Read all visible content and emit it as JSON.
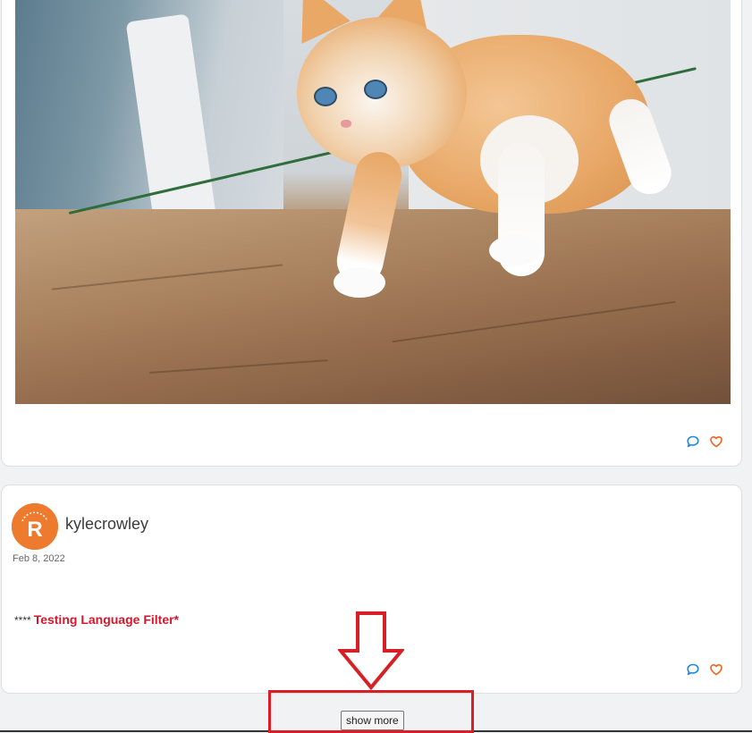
{
  "posts": [
    {
      "image_alt": "orange and white kitten walking on a wooden table",
      "actions": {
        "comment_icon": "comment-icon",
        "like_icon": "heart-icon"
      }
    },
    {
      "avatar_letter": "R",
      "username": "kylecrowley",
      "date": "Feb 8, 2022",
      "censored": "****",
      "message": "Testing Language Filter*",
      "actions": {
        "comment_icon": "comment-icon",
        "like_icon": "heart-icon"
      }
    }
  ],
  "show_more_label": "show more",
  "colors": {
    "comment_icon": "#1e88e5",
    "heart_icon": "#f0651f",
    "avatar": "#ee7a2e",
    "highlight_red": "#d3182b",
    "annotation_red": "#d81f26"
  }
}
